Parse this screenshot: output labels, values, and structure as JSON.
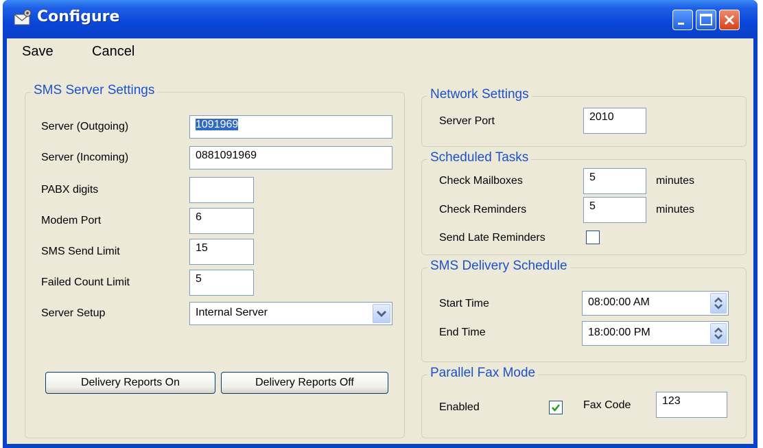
{
  "window": {
    "title": "Configure"
  },
  "menu": {
    "save": "Save",
    "cancel": "Cancel"
  },
  "sms_server": {
    "legend": "SMS Server Settings",
    "server_outgoing_label": "Server (Outgoing)",
    "server_outgoing_value": "1091969",
    "server_incoming_label": "Server (Incoming)",
    "server_incoming_value": "0881091969",
    "pabx_label": "PABX digits",
    "pabx_value": "",
    "modem_port_label": "Modem Port",
    "modem_port_value": "6",
    "send_limit_label": "SMS Send Limit",
    "send_limit_value": "15",
    "failed_limit_label": "Failed Count Limit",
    "failed_limit_value": "5",
    "setup_label": "Server Setup",
    "setup_value": "Internal Server",
    "delivery_on": "Delivery Reports On",
    "delivery_off": "Delivery Reports Off"
  },
  "network": {
    "legend": "Network Settings",
    "port_label": "Server Port",
    "port_value": "2010"
  },
  "scheduled": {
    "legend": "Scheduled Tasks",
    "mailboxes_label": "Check Mailboxes",
    "mailboxes_value": "5",
    "reminders_label": "Check Reminders",
    "reminders_value": "5",
    "unit": "minutes",
    "late_label": "Send Late Reminders",
    "late_checked": false
  },
  "delivery": {
    "legend": "SMS Delivery Schedule",
    "start_label": "Start Time",
    "start_value": "08:00:00 AM",
    "end_label": "End Time",
    "end_value": "18:00:00 PM"
  },
  "fax": {
    "legend": "Parallel Fax Mode",
    "enabled_label": "Enabled",
    "enabled_checked": true,
    "code_label": "Fax Code",
    "code_value": "123"
  },
  "colors": {
    "title_bar": "#0a46d8",
    "legend_text": "#1c52c8",
    "dialog_bg": "#ece9d8"
  }
}
